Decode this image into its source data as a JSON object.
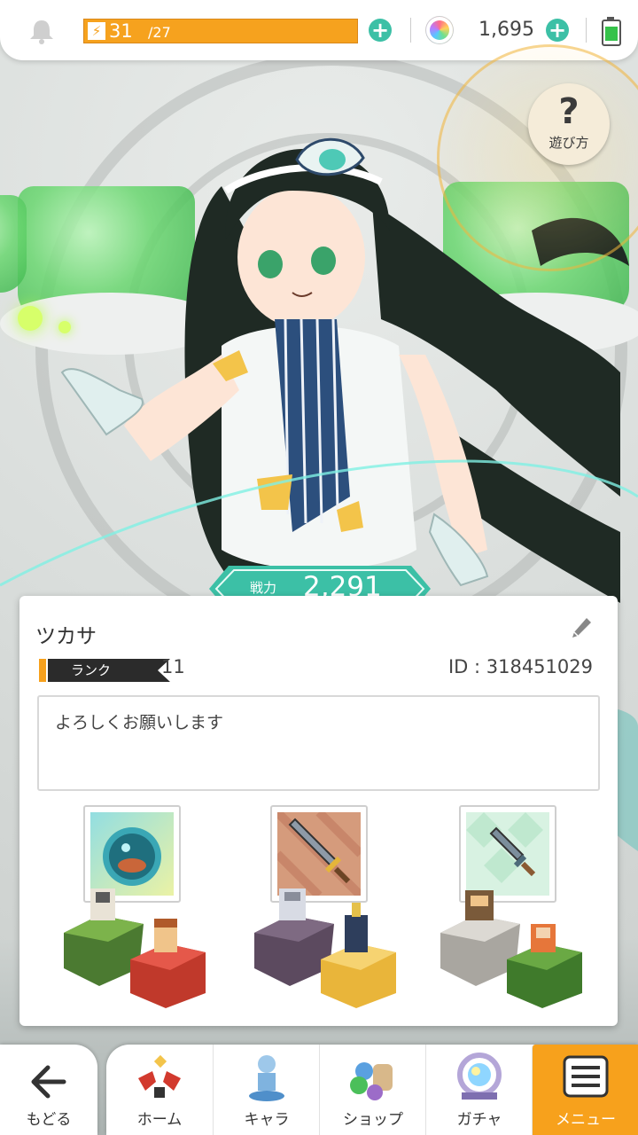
{
  "status_bar": {
    "stamina_current": "31",
    "stamina_max": "/27",
    "gems": "1,695"
  },
  "help_button": {
    "label": "遊び方",
    "icon": "question-mark"
  },
  "power": {
    "label": "戦力",
    "value": "2,291"
  },
  "profile": {
    "name": "ツカサ",
    "rank_label": "ランク",
    "rank_value": "11",
    "player_id": "ID : 318451029",
    "comment": "よろしくお願いします",
    "equipment": [
      {
        "icon": "orb-item-icon"
      },
      {
        "icon": "sword-item-icon"
      },
      {
        "icon": "dagger-item-icon"
      }
    ]
  },
  "bottom_nav": {
    "back_label": "もどる",
    "tabs": [
      {
        "label": "ホーム",
        "icon": "home-icon"
      },
      {
        "label": "キャラ",
        "icon": "character-icon"
      },
      {
        "label": "ショップ",
        "icon": "shop-icon"
      },
      {
        "label": "ガチャ",
        "icon": "gacha-icon"
      },
      {
        "label": "メニュー",
        "icon": "menu-icon",
        "active": true
      }
    ]
  },
  "colors": {
    "accent": "#3cc0a6",
    "stamina": "#f6a21e",
    "active_tab": "#f7a11c"
  }
}
